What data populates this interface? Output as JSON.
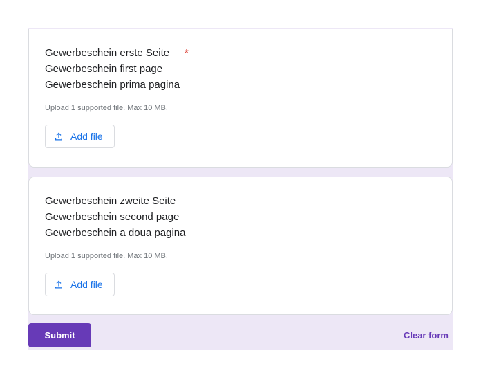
{
  "questions": [
    {
      "lines": [
        "Gewerbeschein erste Seite",
        "Gewerbeschein first page",
        "Gewerbeschein prima pagina"
      ],
      "required_mark": "*",
      "hint": "Upload 1 supported file. Max 10 MB.",
      "button_label": "Add file",
      "button_icon": "upload-icon"
    },
    {
      "lines": [
        "Gewerbeschein zweite Seite",
        "Gewerbeschein second page",
        "Gewerbeschein a doua pagina"
      ],
      "hint": "Upload 1 supported file. Max 10 MB.",
      "button_label": "Add file",
      "button_icon": "upload-icon"
    }
  ],
  "footer": {
    "submit_label": "Submit",
    "clear_label": "Clear form"
  },
  "colors": {
    "accent": "#673ab7",
    "form_background": "#ede7f6",
    "link_blue": "#1a73e8",
    "required_red": "#d93025"
  }
}
